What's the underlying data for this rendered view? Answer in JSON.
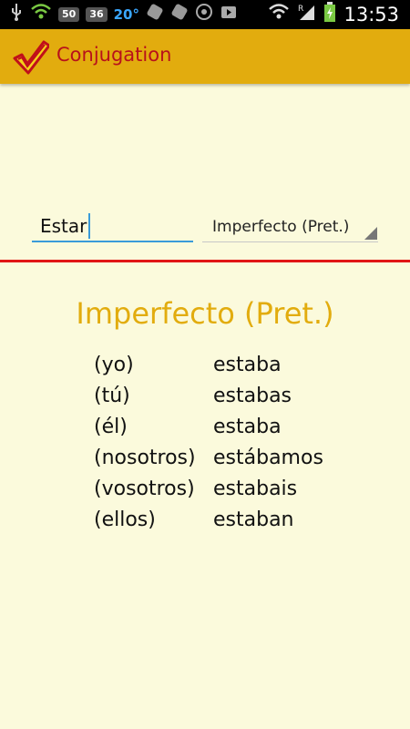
{
  "status_bar": {
    "left_icons": [
      "usb-icon",
      "wifi-icon"
    ],
    "badge_50": "50",
    "badge_36": "36",
    "temperature": "20°",
    "time": "13:53",
    "network_letter": "R"
  },
  "app": {
    "title": "Conjugation",
    "logo": "checkmark-logo"
  },
  "form": {
    "verb_value": "Estar",
    "tense_selected": "Imperfecto (Pret.)"
  },
  "result": {
    "heading": "Imperfecto (Pret.)",
    "rows": [
      {
        "pronoun": "(yo)",
        "form": "estaba"
      },
      {
        "pronoun": "(tú)",
        "form": "estabas"
      },
      {
        "pronoun": "(él)",
        "form": "estaba"
      },
      {
        "pronoun": "(nosotros)",
        "form": "estábamos"
      },
      {
        "pronoun": "(vosotros)",
        "form": "estabais"
      },
      {
        "pronoun": "(ellos)",
        "form": "estaban"
      }
    ]
  },
  "colors": {
    "accent": "#e2ac0e",
    "title_red": "#b8111b",
    "divider": "#e11616",
    "background": "#fbfadc",
    "input_underline": "#3a9bd9"
  }
}
